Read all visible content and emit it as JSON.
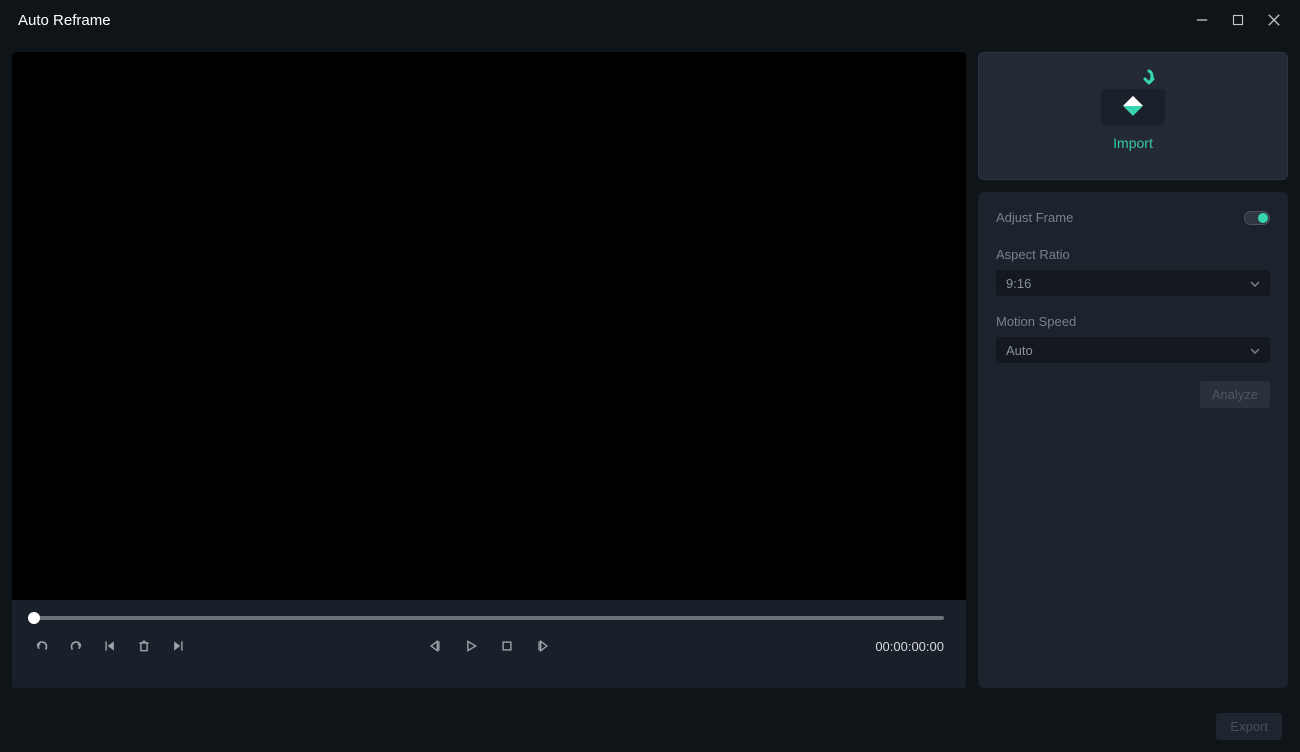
{
  "window": {
    "title": "Auto Reframe"
  },
  "timeline": {
    "timecode": "00:00:00:00"
  },
  "import": {
    "label": "Import"
  },
  "settings": {
    "adjust_frame_label": "Adjust Frame",
    "adjust_frame_on": true,
    "aspect_ratio_label": "Aspect Ratio",
    "aspect_ratio_value": "9:16",
    "motion_speed_label": "Motion Speed",
    "motion_speed_value": "Auto",
    "analyze_label": "Analyze"
  },
  "footer": {
    "export_label": "Export"
  }
}
